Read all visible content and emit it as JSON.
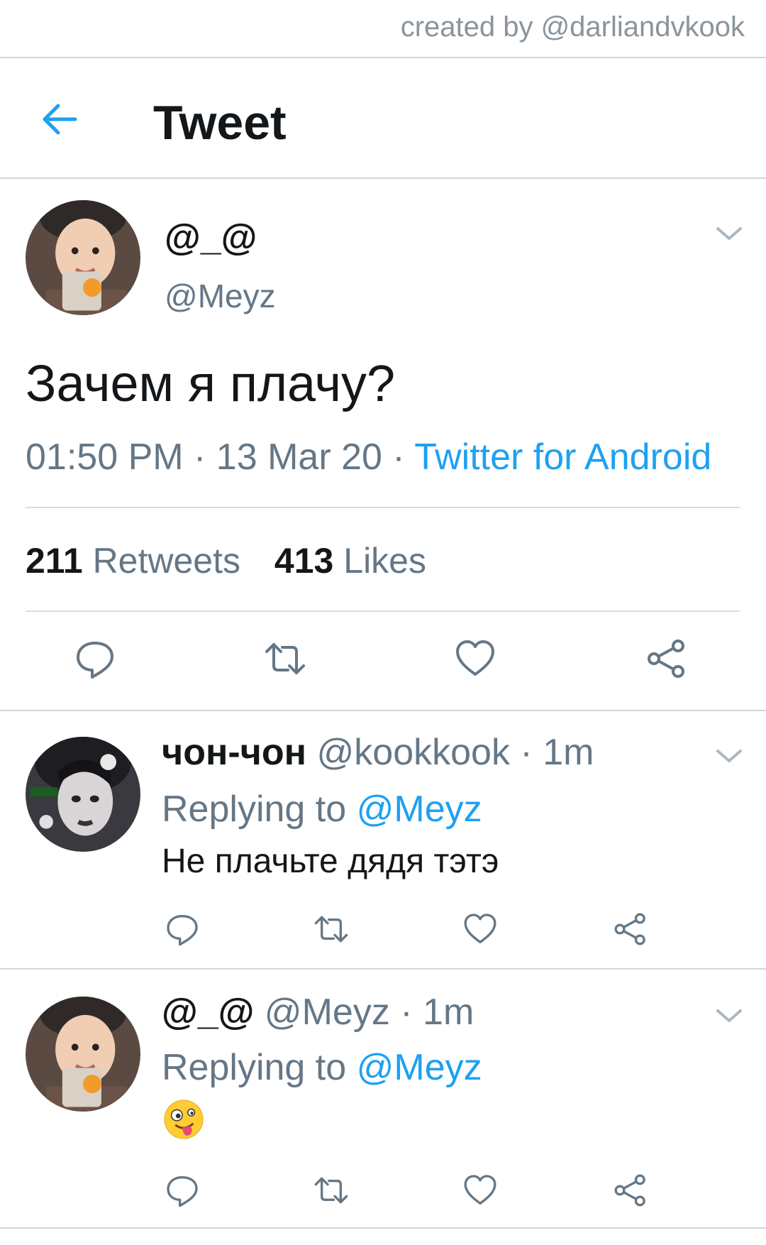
{
  "watermark": "created by @darliandvkook",
  "header": {
    "title": "Tweet",
    "back_icon": "arrow-left-icon"
  },
  "tweet": {
    "name": "@_@",
    "handle": "@Meyz",
    "text": "Зачем я плачу?",
    "time": "01:50 PM",
    "date": "13 Mar 20",
    "source": "Twitter for Android",
    "retweets_count": "211",
    "retweets_label": "Retweets",
    "likes_count": "413",
    "likes_label": "Likes"
  },
  "replies": [
    {
      "name": "чон-чон",
      "handle": "@kookkook",
      "time": "1m",
      "replying_label": "Replying to",
      "replying_to": "@Meyz",
      "text": "Не плачьте дядя тэтэ"
    },
    {
      "name": "@_@",
      "handle": "@Meyz",
      "time": "1m",
      "replying_label": "Replying to",
      "replying_to": "@Meyz",
      "text": "",
      "emoji": "zany-face-emoji"
    }
  ],
  "colors": {
    "accent": "#1da1f2",
    "secondary_text": "#657786",
    "divider": "#d0d6dc"
  }
}
